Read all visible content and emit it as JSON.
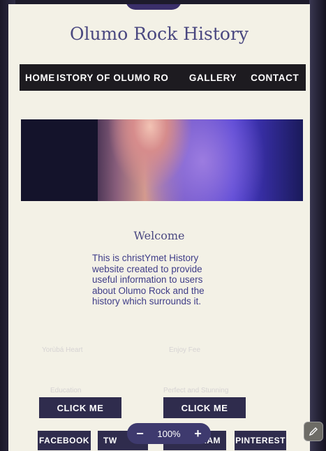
{
  "site": {
    "title": "Olumo Rock History"
  },
  "nav": {
    "items": [
      "HOME",
      "HISTORY OF OLUMO ROCK",
      "GALLERY",
      "CONTACT"
    ],
    "visible_items": [
      "HOME",
      "ISTORY OF OLUMO RO",
      "GALLERY",
      "CONTACT"
    ]
  },
  "welcome": {
    "title": "Welcome",
    "text": "This is christYmet History website created to provide useful information to users about Olumo Rock and the history which surrounds it."
  },
  "faint_labels": [
    "Yorùbá Heart",
    "Enjoy Fee",
    "Education",
    "Perfect and Stunning"
  ],
  "buttons": {
    "click_left": "CLICK ME",
    "click_right": "CLICK ME"
  },
  "social": {
    "facebook": "FACEBOOK",
    "twitter_partial": "TW",
    "instagram_partial": "RAM",
    "pinterest": "PINTEREST"
  },
  "zoom": {
    "minus": "−",
    "level": "100%",
    "plus": "+"
  },
  "icons": {
    "edit": "pencil-icon"
  },
  "colors": {
    "accent": "#2f2c4d",
    "title": "#4a4880",
    "nav_bg": "#1d1b20",
    "page_bg": "#f3f1e6"
  }
}
